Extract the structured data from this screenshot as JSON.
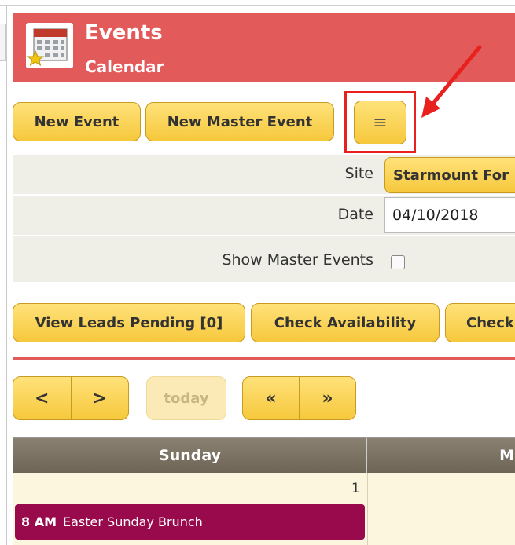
{
  "header": {
    "title": "Events",
    "subtitle": "Calendar"
  },
  "toolbar": {
    "new_event": "New Event",
    "new_master_event": "New Master Event",
    "menu_glyph": "≡"
  },
  "form": {
    "site_label": "Site",
    "site_value": "Starmount For",
    "date_label": "Date",
    "date_value": "04/10/2018",
    "show_master_label": "Show Master Events"
  },
  "actions": {
    "leads_pending": "View Leads Pending [0]",
    "check_availability": "Check Availability",
    "check_other": "Check"
  },
  "nav": {
    "prev": "<",
    "next": ">",
    "today": "today",
    "prev_year": "«",
    "next_year": "»"
  },
  "calendar": {
    "columns": [
      "Sunday",
      "M"
    ],
    "day_number": "1",
    "event_time": "8 AM",
    "event_title": "Easter Sunday Brunch"
  },
  "colors": {
    "header": "#e35a5a",
    "button": "#f6c83c",
    "event": "#990a4c",
    "highlight": "#e8201e"
  }
}
